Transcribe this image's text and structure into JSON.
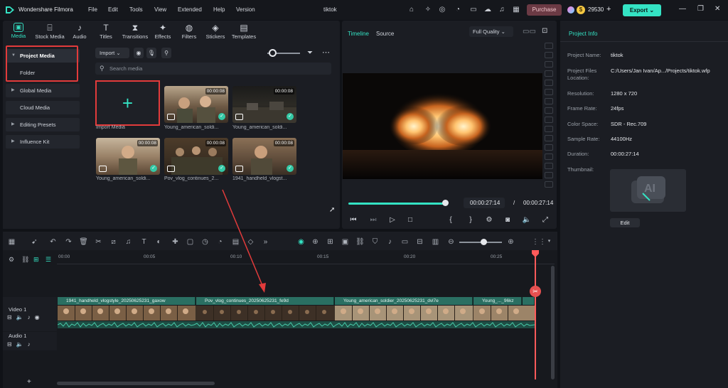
{
  "app": {
    "name": "Wondershare Filmora",
    "doc_title": "tiktok"
  },
  "menu": [
    "File",
    "Edit",
    "Tools",
    "View",
    "Extended",
    "Help",
    "Version"
  ],
  "titlebar": {
    "purchase": "Purchase",
    "credits": "29530",
    "export": "Export"
  },
  "media_tabs": [
    {
      "label": "Media",
      "icon": "media-icon"
    },
    {
      "label": "Stock Media",
      "icon": "stock-media-icon"
    },
    {
      "label": "Audio",
      "icon": "audio-icon"
    },
    {
      "label": "Titles",
      "icon": "titles-icon"
    },
    {
      "label": "Transitions",
      "icon": "transitions-icon"
    },
    {
      "label": "Effects",
      "icon": "effects-icon"
    },
    {
      "label": "Filters",
      "icon": "filters-icon"
    },
    {
      "label": "Stickers",
      "icon": "stickers-icon"
    },
    {
      "label": "Templates",
      "icon": "templates-icon"
    }
  ],
  "sidebar": {
    "items": [
      {
        "label": "Project Media",
        "expanded": true
      },
      {
        "label": "Folder"
      },
      {
        "label": "Global Media"
      },
      {
        "label": "Cloud Media"
      },
      {
        "label": "Editing Presets"
      },
      {
        "label": "Influence Kit"
      }
    ]
  },
  "media": {
    "import_label": "Import",
    "search_placeholder": "Search media",
    "import_tile_label": "Import Media",
    "items": [
      {
        "name": "Young_american_soldi...",
        "duration": "00:00:08"
      },
      {
        "name": "Young_american_soldi...",
        "duration": "00:00:08"
      },
      {
        "name": "Young_american_soldi...",
        "duration": "00:00:08"
      },
      {
        "name": "Pov_vlog_continues_2...",
        "duration": "00:00:08"
      },
      {
        "name": "1941_handheld_vlogst...",
        "duration": "00:00:08"
      }
    ]
  },
  "player": {
    "tab_timeline": "Timeline",
    "tab_source": "Source",
    "quality": "Full Quality",
    "current_time": "00:00:27:14",
    "separator": "/",
    "total_time": "00:00:27:14",
    "progress": 1.0
  },
  "info": {
    "title": "Project Info",
    "rows": [
      {
        "label": "Project Name:",
        "value": "tiktok"
      },
      {
        "label": "Project Files Location:",
        "value": "C:/Users/Jan Ivan/Ap.../Projects/tiktok.wfp"
      },
      {
        "label": "Resolution:",
        "value": "1280 x 720"
      },
      {
        "label": "Frame Rate:",
        "value": "24fps"
      },
      {
        "label": "Color Space:",
        "value": "SDR - Rec.709"
      },
      {
        "label": "Sample Rate:",
        "value": "44100Hz"
      },
      {
        "label": "Duration:",
        "value": "00:00:27:14"
      },
      {
        "label": "Thumbnail:",
        "value": ""
      }
    ],
    "edit": "Edit"
  },
  "timeline": {
    "ruler": [
      "00:00",
      "00:05",
      "00:10",
      "00:15",
      "00:20",
      "00:25"
    ],
    "video_track": "Video 1",
    "audio_track": "Audio 1",
    "clips": [
      "1941_handheld_vlogstyle_20250625231_gaxow",
      "Pov_vlog_continues_20250625231_fe9d",
      "Young_american_soldier_20250625231_dvl7e",
      "Young_..._96kz"
    ]
  }
}
